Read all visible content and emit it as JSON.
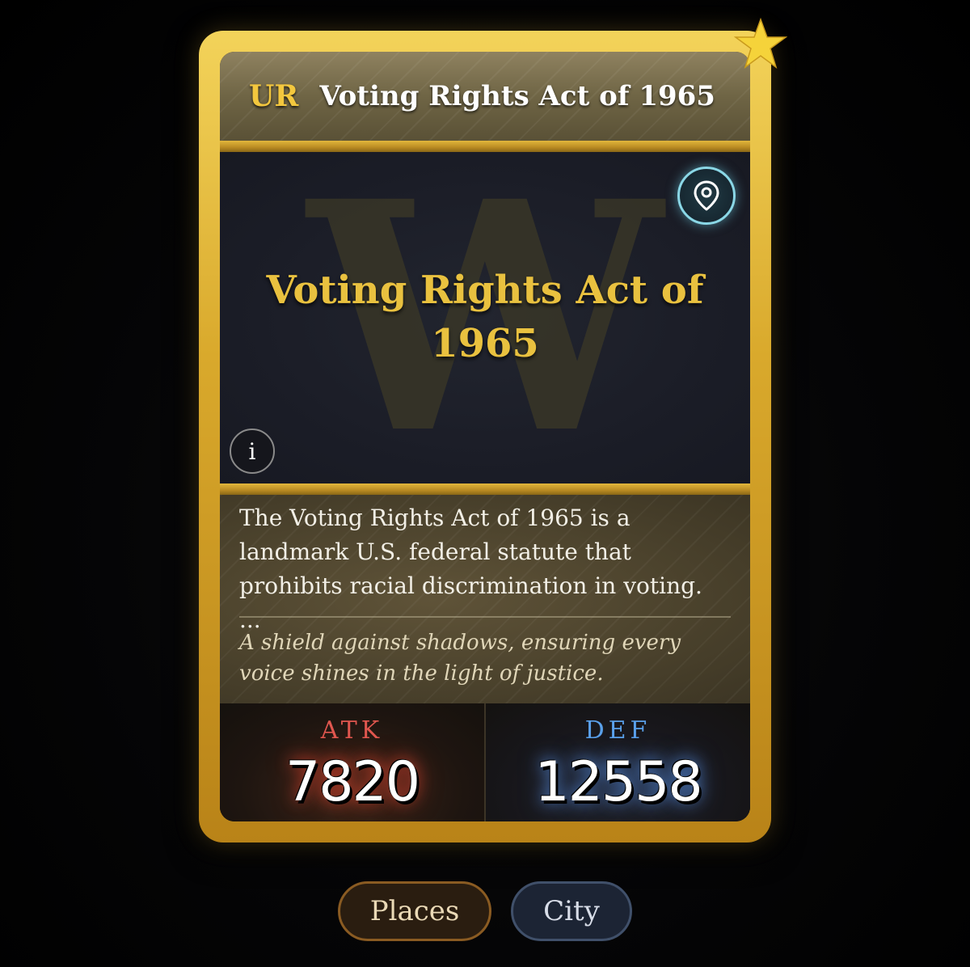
{
  "card": {
    "rarity": "UR",
    "title": "Voting Rights Act of 1965",
    "art_letter": "W",
    "art_title": "Voting Rights Act of 1965",
    "info_glyph": "i",
    "description": "The Voting Rights Act of 1965 is a landmark U.S. federal statute that prohibits racial discrimination in voting. ...",
    "flavor": "A shield against shadows, ensuring every voice shines in the light of justice.",
    "stats": {
      "atk_label": "ATK",
      "atk_value": "7820",
      "def_label": "DEF",
      "def_value": "12558"
    },
    "icons": {
      "corner": "star-icon",
      "location": "map-pin-icon",
      "info": "info-icon"
    }
  },
  "tags": [
    {
      "label": "Places"
    },
    {
      "label": "City"
    }
  ],
  "colors": {
    "frame_gold": "#e4b83a",
    "rarity_gold": "#f3c73e",
    "art_title_gold": "#e9c13f",
    "atk_red": "#e0574f",
    "def_blue": "#5aa0ea",
    "location_cyan": "#8ad7e6"
  }
}
